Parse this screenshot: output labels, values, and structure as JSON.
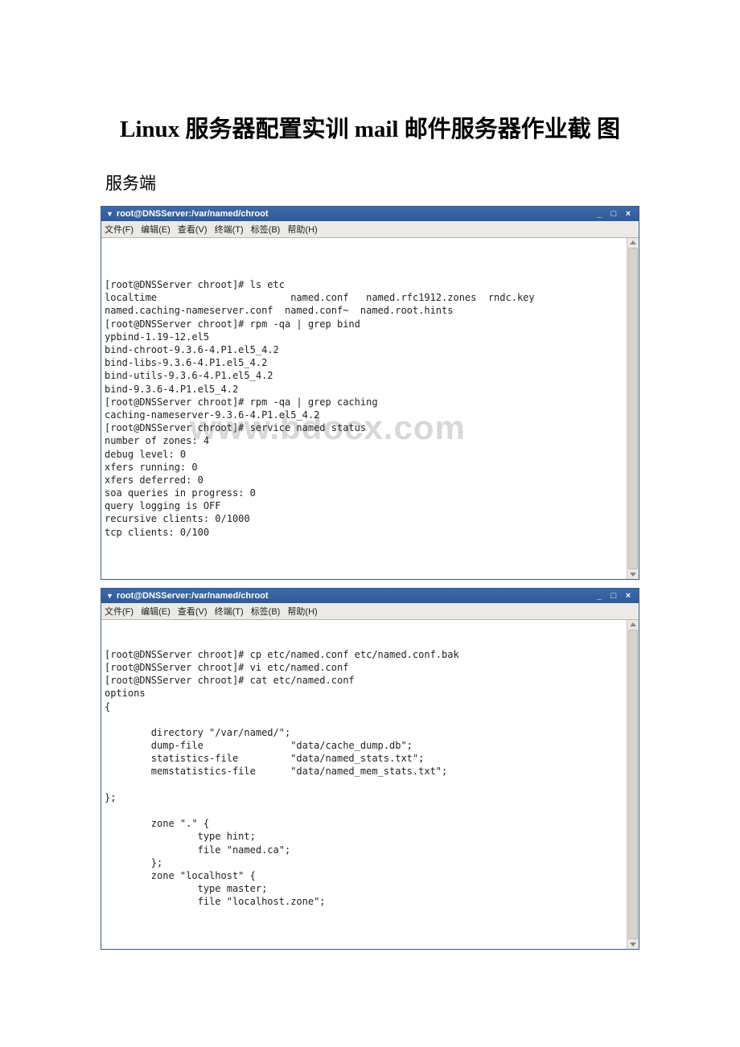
{
  "title_line": "Linux 服务器配置实训 mail 邮件服务器作业截\n图",
  "section_heading": "服务端",
  "terminal1": {
    "titlebar": "root@DNSServer:/var/named/chroot",
    "menu": [
      "文件(F)",
      "编辑(E)",
      "查看(V)",
      "终端(T)",
      "标签(B)",
      "帮助(H)"
    ],
    "body": "[root@DNSServer chroot]# ls etc\nlocaltime                       named.conf   named.rfc1912.zones  rndc.key\nnamed.caching-nameserver.conf  named.conf~  named.root.hints\n[root@DNSServer chroot]# rpm -qa | grep bind\nypbind-1.19-12.el5\nbind-chroot-9.3.6-4.P1.el5_4.2\nbind-libs-9.3.6-4.P1.el5_4.2\nbind-utils-9.3.6-4.P1.el5_4.2\nbind-9.3.6-4.P1.el5_4.2\n[root@DNSServer chroot]# rpm -qa | grep caching\ncaching-nameserver-9.3.6-4.P1.el5_4.2\n[root@DNSServer chroot]# service named status\nnumber of zones: 4\ndebug level: 0\nxfers running: 0\nxfers deferred: 0\nsoa queries in progress: 0\nquery logging is OFF\nrecursive clients: 0/1000\ntcp clients: 0/100",
    "watermark": "www.bdocx.com"
  },
  "terminal2": {
    "titlebar": "root@DNSServer:/var/named/chroot",
    "menu": [
      "文件(F)",
      "编辑(E)",
      "查看(V)",
      "终端(T)",
      "标签(B)",
      "帮助(H)"
    ],
    "body": "[root@DNSServer chroot]# cp etc/named.conf etc/named.conf.bak\n[root@DNSServer chroot]# vi etc/named.conf\n[root@DNSServer chroot]# cat etc/named.conf\noptions\n{\n\n        directory \"/var/named/\";\n        dump-file               \"data/cache_dump.db\";\n        statistics-file         \"data/named_stats.txt\";\n        memstatistics-file      \"data/named_mem_stats.txt\";\n\n};\n\n        zone \".\" {\n                type hint;\n                file \"named.ca\";\n        };\n        zone \"localhost\" {\n                type master;\n                file \"localhost.zone\";"
  }
}
